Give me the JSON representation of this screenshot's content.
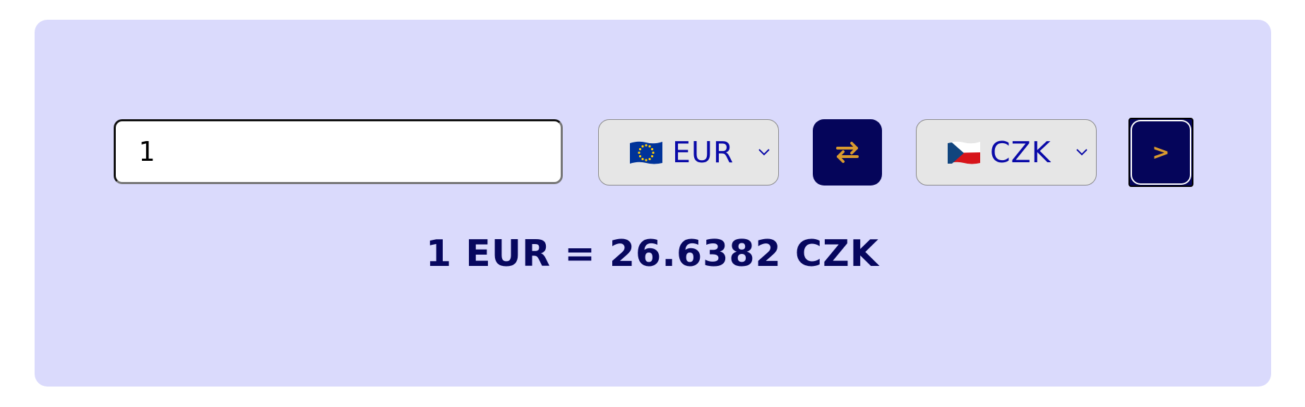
{
  "converter": {
    "amount_value": "1",
    "from_currency": {
      "code": "EUR",
      "flag": "eu-flag-icon"
    },
    "to_currency": {
      "code": "CZK",
      "flag": "cz-flag-icon"
    },
    "swap_icon": "swap-arrows-icon",
    "go_label": ">",
    "result_text": "1 EUR = 26.6382 CZK"
  },
  "colors": {
    "card_background": "#dadafc",
    "button_background": "#05055a",
    "accent_orange": "#d99a2e",
    "currency_code_color": "#0a0aa8",
    "result_color": "#07075e"
  }
}
